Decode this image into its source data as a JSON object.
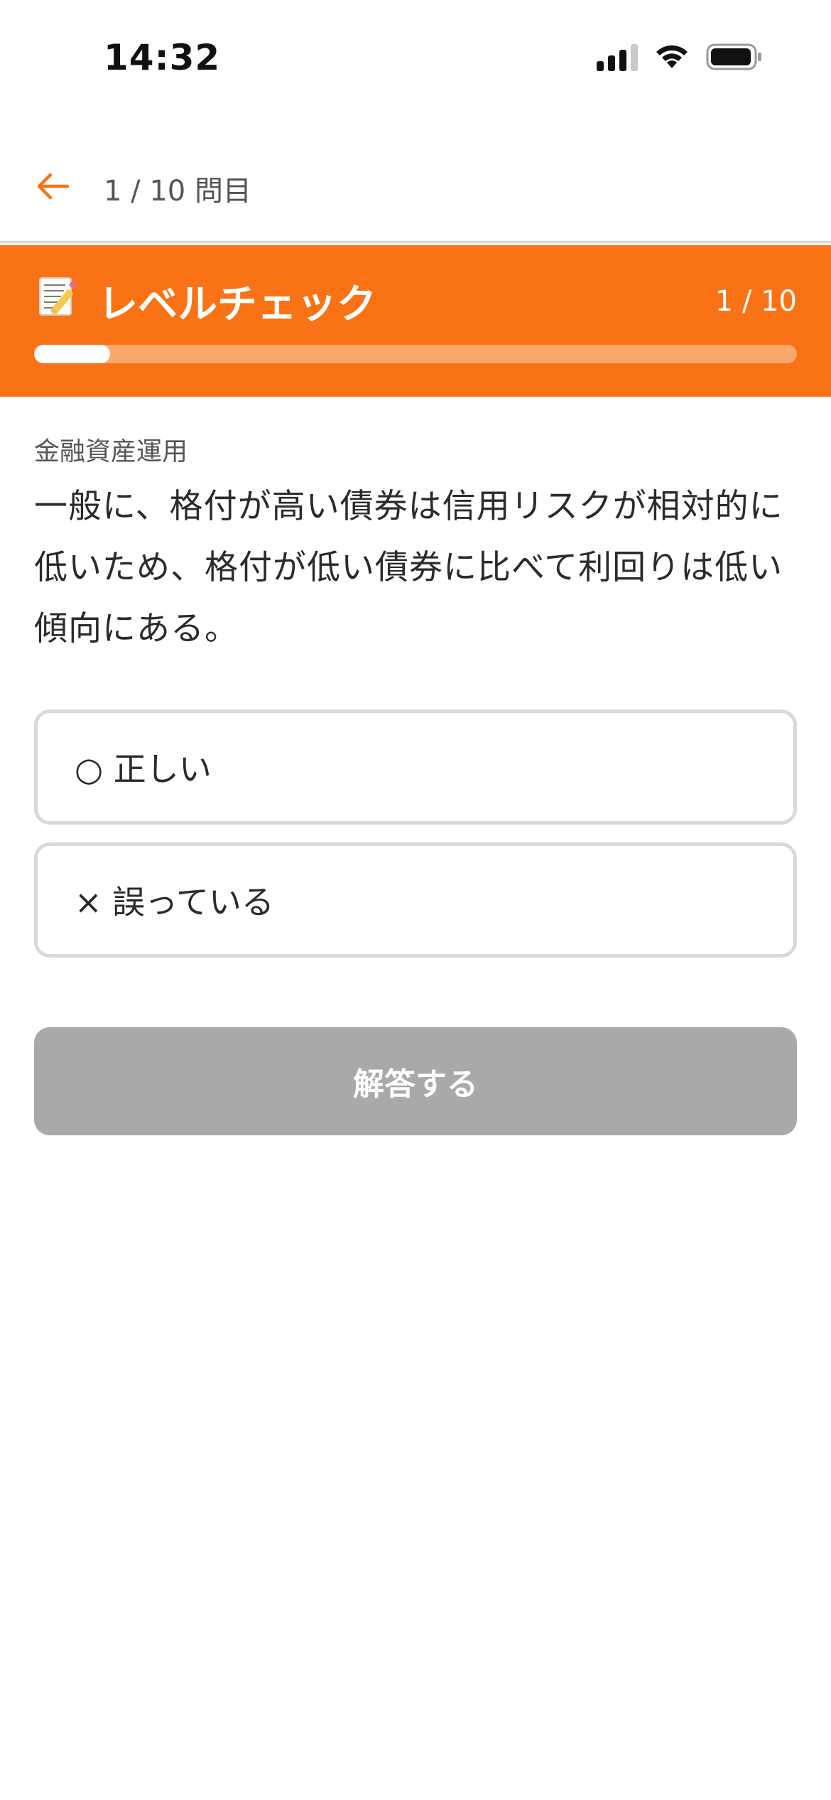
{
  "status_bar": {
    "time": "14:32",
    "icons": [
      "cellular-signal-icon",
      "wifi-icon",
      "battery-icon"
    ]
  },
  "nav": {
    "back_icon": "arrow-left-icon",
    "progress_label": "1 / 10 問目"
  },
  "banner": {
    "emoji": "memo-icon",
    "title": "レベルチェック",
    "count": "1 / 10",
    "progress": {
      "current": 1,
      "total": 10
    }
  },
  "question": {
    "category": "金融資産運用",
    "text": "一般に、格付が高い債券は信用リスクが相対的に低いため、格付が低い債券に比べて利回りは低い傾向にある。"
  },
  "options": [
    {
      "label": "○ 正しい"
    },
    {
      "label": "× 誤っている"
    }
  ],
  "submit": {
    "label": "解答する",
    "state": "disabled"
  },
  "colors": {
    "accent": "#f97316",
    "disabled_button": "#a9a9a9",
    "option_border": "#d9d9d9"
  }
}
